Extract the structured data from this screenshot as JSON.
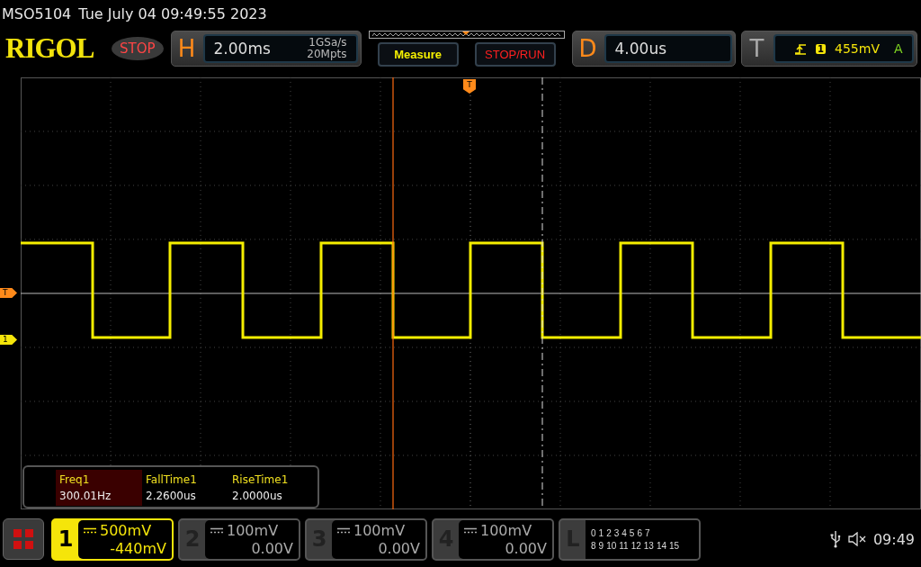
{
  "model": "MSO5104",
  "datetime": "Tue July 04 09:49:55 2023",
  "logo": "RIGOL",
  "run_state": "STOP",
  "horizontal": {
    "label": "H",
    "scale": "2.00ms",
    "sample_rate": "1GSa/s",
    "memory_depth": "20Mpts"
  },
  "buttons": [
    {
      "label": "Measure",
      "kind": "measure"
    },
    {
      "label": "STOP/RUN",
      "kind": "run"
    }
  ],
  "delay": {
    "label": "D",
    "value": "4.00us"
  },
  "trigger": {
    "label": "T",
    "source": "1",
    "level": "455mV",
    "mode": "A"
  },
  "trigger_position_marker": "T",
  "level_markers": [
    {
      "label": "T",
      "kind": "trigger"
    },
    {
      "label": "1",
      "kind": "channel"
    }
  ],
  "measurements": [
    {
      "name": "Freq1",
      "value": "300.01Hz",
      "selected": true
    },
    {
      "name": "FallTime1",
      "value": "2.2600us",
      "selected": false
    },
    {
      "name": "RiseTime1",
      "value": "2.0000us",
      "selected": false
    }
  ],
  "channels": [
    {
      "number": "1",
      "scale": "500mV",
      "offset": "-440mV",
      "on": true
    },
    {
      "number": "2",
      "scale": "100mV",
      "offset": "0.00V",
      "on": false
    },
    {
      "number": "3",
      "scale": "100mV",
      "offset": "0.00V",
      "on": false
    },
    {
      "number": "4",
      "scale": "100mV",
      "offset": "0.00V",
      "on": false
    }
  ],
  "logic": {
    "label": "L",
    "row_1": [
      "0",
      "1",
      "2",
      "3",
      "4",
      "5",
      "6",
      "7"
    ],
    "row_2": [
      "8",
      "9",
      "10",
      "11",
      "12",
      "13",
      "14",
      "15"
    ]
  },
  "status": {
    "time": "09:49"
  }
}
